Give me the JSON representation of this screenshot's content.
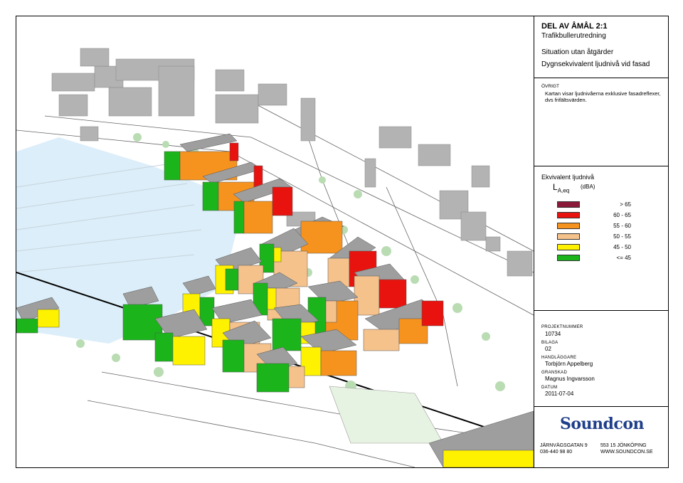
{
  "title_block": {
    "title": "DEL AV ÅMÅL 2:1",
    "subtitle": "Trafikbullerutredning",
    "situation": "Situation utan åtgärder",
    "description": "Dygnsekvivalent ljudnivå vid fasad"
  },
  "note": {
    "heading": "ÖVRIGT",
    "text": "Kartan visar ljudnivåerna exklusive fasadreflexer, dvs frifältsvärden."
  },
  "legend": {
    "title": "Ekvivalent ljudnivå",
    "symbol": "L",
    "symbol_sub": "A,eq",
    "unit": "(dBA)",
    "classes": [
      {
        "range": ">   65",
        "color": "#8b1a3a"
      },
      {
        "range": "60 -   65",
        "color": "#e8130f"
      },
      {
        "range": "55 -   60",
        "color": "#f6931e"
      },
      {
        "range": "50 -   55",
        "color": "#f5c28c"
      },
      {
        "range": "45 -   50",
        "color": "#fff200"
      },
      {
        "range": "<= 45",
        "color": "#1bb51b"
      }
    ]
  },
  "project": {
    "number_label": "PROJEKTNUMMER",
    "number": "10734",
    "bilaga_label": "BILAGA",
    "bilaga": "02",
    "handler_label": "HANDLÄGGARE",
    "handler": "Torbjörn Appelberg",
    "reviewer_label": "GRANSKAD",
    "reviewer": "Magnus Ingvarsson",
    "date_label": "DATUM",
    "date": "2011-07-04"
  },
  "company": {
    "logo_text": "Soundcon",
    "address_street": "JÄRNVÄGSGATAN 9",
    "address_city": "553 15 JÖNKÖPING",
    "phone": "036-440 98 80",
    "web": "WWW.SOUNDCON.SE"
  }
}
